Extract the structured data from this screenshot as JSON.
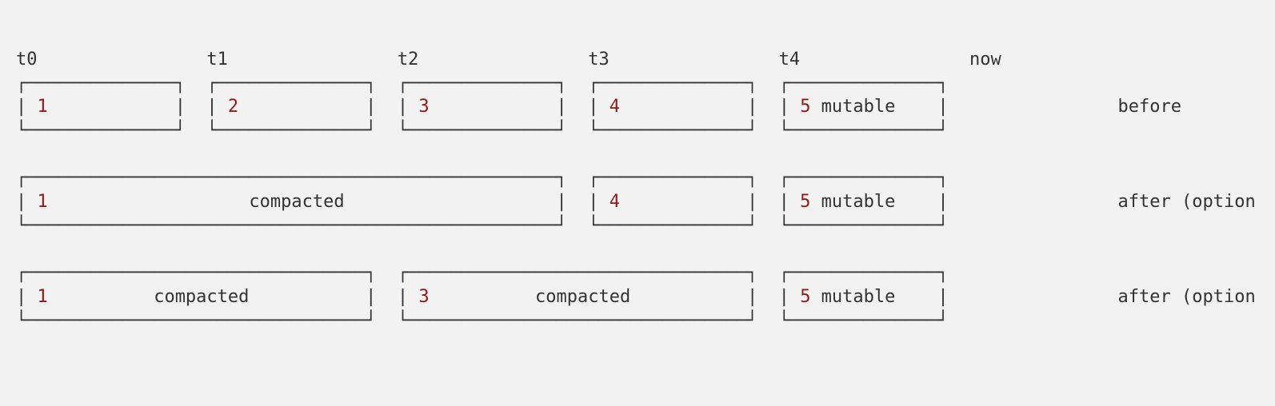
{
  "colors": {
    "bg": "#f2f2f2",
    "text": "#333333",
    "highlight": "#8f1a1a"
  },
  "timeline": [
    "t0",
    "t1",
    "t2",
    "t3",
    "t4",
    "now"
  ],
  "rows": [
    {
      "label": "before",
      "blocks": [
        {
          "id": "1",
          "span": 1,
          "text": ""
        },
        {
          "id": "2",
          "span": 1,
          "text": ""
        },
        {
          "id": "3",
          "span": 1,
          "text": ""
        },
        {
          "id": "4",
          "span": 1,
          "text": ""
        },
        {
          "id": "5",
          "span": 1,
          "text": "mutable"
        }
      ]
    },
    {
      "label": "after (option",
      "blocks": [
        {
          "id": "1",
          "span": 3,
          "text": "compacted"
        },
        {
          "id": "4",
          "span": 1,
          "text": ""
        },
        {
          "id": "5",
          "span": 1,
          "text": "mutable"
        }
      ]
    },
    {
      "label": "after (option",
      "blocks": [
        {
          "id": "1",
          "span": 2,
          "text": "compacted"
        },
        {
          "id": "3",
          "span": 2,
          "text": "compacted"
        },
        {
          "id": "5",
          "span": 1,
          "text": "mutable"
        }
      ]
    }
  ]
}
